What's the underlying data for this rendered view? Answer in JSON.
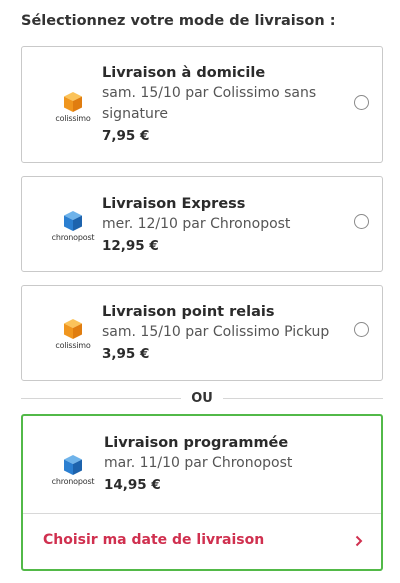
{
  "heading": "Sélectionnez votre mode de livraison :",
  "options": [
    {
      "name": "Livraison à domicile",
      "description": "sam. 15/10 par Colissimo sans signature",
      "price": "7,95 €",
      "carrier_logo": "colissimo",
      "icon": "package-box-icon",
      "selected": false
    },
    {
      "name": "Livraison Express",
      "description": "mer. 12/10 par Chronopost",
      "price": "12,95 €",
      "carrier_logo": "chronopost",
      "icon": "package-box-icon",
      "selected": false
    },
    {
      "name": "Livraison point relais",
      "description": "sam. 15/10 par Colissimo Pickup",
      "price": "3,95 €",
      "carrier_logo": "colissimo",
      "icon": "package-box-icon",
      "selected": false
    }
  ],
  "separator": "OU",
  "scheduled": {
    "name": "Livraison programmée",
    "description": "mar. 11/10 par Chronopost",
    "price": "14,95 €",
    "carrier_logo": "chronopost",
    "link_label": "Choisir ma date de livraison",
    "link_icon": "chevron-right-icon"
  },
  "colors": {
    "colissimo_box": "#f5a623",
    "chronopost_box": "#2b7fd1",
    "selected_border": "#52b948",
    "link": "#d0304f"
  }
}
